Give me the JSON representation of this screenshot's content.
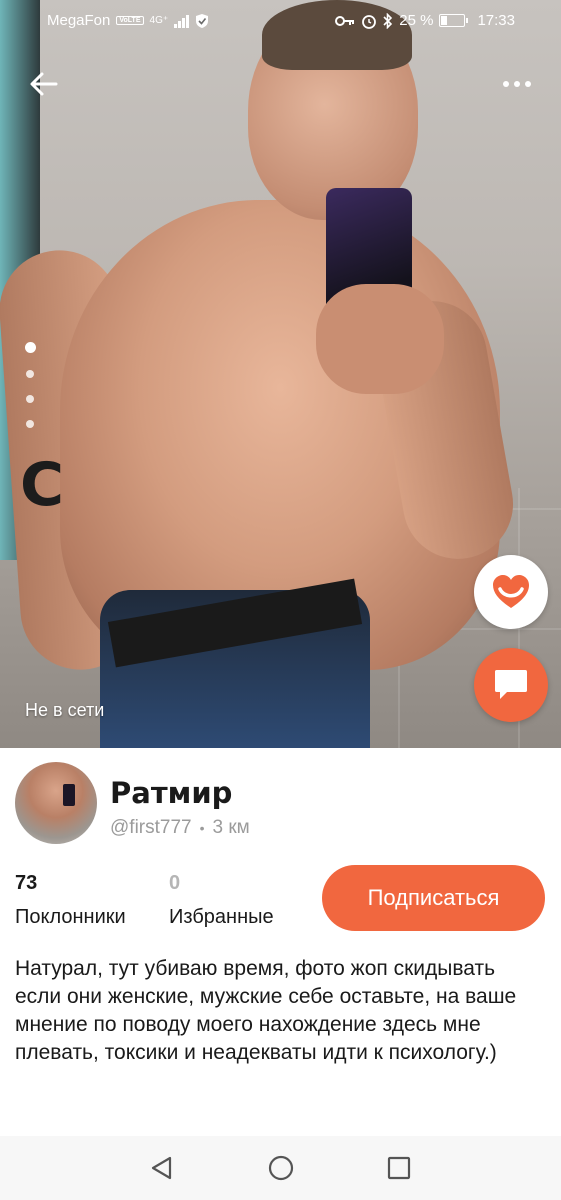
{
  "status_bar": {
    "carrier": "MegaFon",
    "volte": "VoLTE",
    "network": "4G⁺",
    "battery_percent": "25 %",
    "battery_level": 0.25,
    "time": "17:33"
  },
  "top_bar": {
    "back_icon": "arrow-left-icon",
    "more_icon": "more-horizontal-icon"
  },
  "photo_gallery": {
    "count": 4,
    "active_index": 0,
    "tattoo_text": "C",
    "online_status": "Не в сети"
  },
  "actions": {
    "like_icon": "heart-smile-icon",
    "chat_icon": "chat-bubble-icon",
    "accent_color": "#f1673f"
  },
  "profile": {
    "name": "Ратмир",
    "username": "@first777",
    "separator": "•",
    "distance": "3 км",
    "stats": [
      {
        "value": "73",
        "label": "Поклонники"
      },
      {
        "value": "0",
        "label": "Избранные"
      }
    ],
    "subscribe_label": "Подписаться",
    "bio": "Натурал, тут убиваю время, фото жоп скидывать если они женские, мужские себе оставьте, на ваше мнение по поводу моего нахождение здесь мне плевать, токсики и неадекваты идти к психологу.)"
  },
  "nav_bar": {
    "back_icon": "triangle-back-icon",
    "home_icon": "circle-home-icon",
    "recents_icon": "square-recents-icon"
  }
}
